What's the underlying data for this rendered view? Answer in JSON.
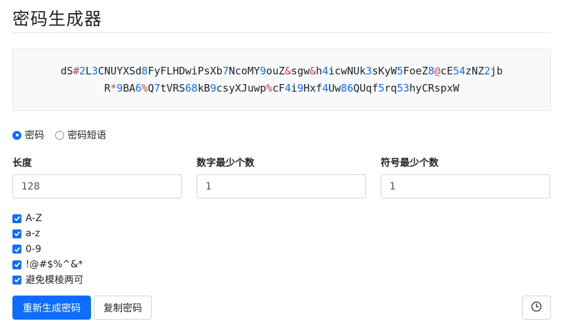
{
  "title": "密码生成器",
  "password": {
    "line1": [
      {
        "t": "dS",
        "k": "l"
      },
      {
        "t": "#",
        "k": "s"
      },
      {
        "t": "2",
        "k": "d"
      },
      {
        "t": "L",
        "k": "l"
      },
      {
        "t": "3",
        "k": "d"
      },
      {
        "t": "CNUYXSd",
        "k": "l"
      },
      {
        "t": "8",
        "k": "d"
      },
      {
        "t": "FyFLHDwiPsXb",
        "k": "l"
      },
      {
        "t": "7",
        "k": "d"
      },
      {
        "t": "NcoMY",
        "k": "l"
      },
      {
        "t": "9",
        "k": "d"
      },
      {
        "t": "ouZ",
        "k": "l"
      },
      {
        "t": "&",
        "k": "s"
      },
      {
        "t": "sgw",
        "k": "l"
      },
      {
        "t": "&",
        "k": "s"
      },
      {
        "t": "h",
        "k": "l"
      },
      {
        "t": "4",
        "k": "d"
      },
      {
        "t": "icwNUk",
        "k": "l"
      },
      {
        "t": "3",
        "k": "d"
      },
      {
        "t": "sKyW",
        "k": "l"
      },
      {
        "t": "5",
        "k": "d"
      },
      {
        "t": "FoeZ",
        "k": "l"
      },
      {
        "t": "8",
        "k": "d"
      },
      {
        "t": "@",
        "k": "s"
      },
      {
        "t": "cE",
        "k": "l"
      },
      {
        "t": "54",
        "k": "d"
      },
      {
        "t": "zNZ",
        "k": "l"
      },
      {
        "t": "2",
        "k": "d"
      },
      {
        "t": "jb",
        "k": "l"
      }
    ],
    "line2": [
      {
        "t": "R",
        "k": "l"
      },
      {
        "t": "*",
        "k": "s"
      },
      {
        "t": "9",
        "k": "d"
      },
      {
        "t": "BA",
        "k": "l"
      },
      {
        "t": "6",
        "k": "d"
      },
      {
        "t": "%",
        "k": "s"
      },
      {
        "t": "Q",
        "k": "l"
      },
      {
        "t": "7",
        "k": "d"
      },
      {
        "t": "tVRS",
        "k": "l"
      },
      {
        "t": "68",
        "k": "d"
      },
      {
        "t": "kB",
        "k": "l"
      },
      {
        "t": "9",
        "k": "d"
      },
      {
        "t": "csyXJuwp",
        "k": "l"
      },
      {
        "t": "%",
        "k": "s"
      },
      {
        "t": "cF",
        "k": "l"
      },
      {
        "t": "4",
        "k": "d"
      },
      {
        "t": "i",
        "k": "l"
      },
      {
        "t": "9",
        "k": "d"
      },
      {
        "t": "Hxf",
        "k": "l"
      },
      {
        "t": "4",
        "k": "d"
      },
      {
        "t": "Uw",
        "k": "l"
      },
      {
        "t": "86",
        "k": "d"
      },
      {
        "t": "QUqf",
        "k": "l"
      },
      {
        "t": "5",
        "k": "d"
      },
      {
        "t": "rq",
        "k": "l"
      },
      {
        "t": "53",
        "k": "d"
      },
      {
        "t": "hyCRspxW",
        "k": "l"
      }
    ]
  },
  "mode": {
    "options": [
      {
        "label": "密码",
        "selected": true
      },
      {
        "label": "密码短语",
        "selected": false
      }
    ]
  },
  "fields": {
    "length": {
      "label": "长度",
      "value": "128"
    },
    "min_numbers": {
      "label": "数字最少个数",
      "value": "1"
    },
    "min_symbols": {
      "label": "符号最少个数",
      "value": "1"
    }
  },
  "options": {
    "uppercase": {
      "label": "A-Z",
      "checked": true
    },
    "lowercase": {
      "label": "a-z",
      "checked": true
    },
    "numbers": {
      "label": "0-9",
      "checked": true
    },
    "symbols": {
      "label": "!@#$%^&*",
      "checked": true
    },
    "avoid_ambiguous": {
      "label": "避免模棱两可",
      "checked": true
    }
  },
  "buttons": {
    "regenerate": "重新生成密码",
    "copy": "复制密码",
    "history_icon": "history-clock-icon"
  },
  "colors": {
    "accent": "#0d6efd",
    "digit": "#0d6efd",
    "symbol": "#dc3545"
  }
}
